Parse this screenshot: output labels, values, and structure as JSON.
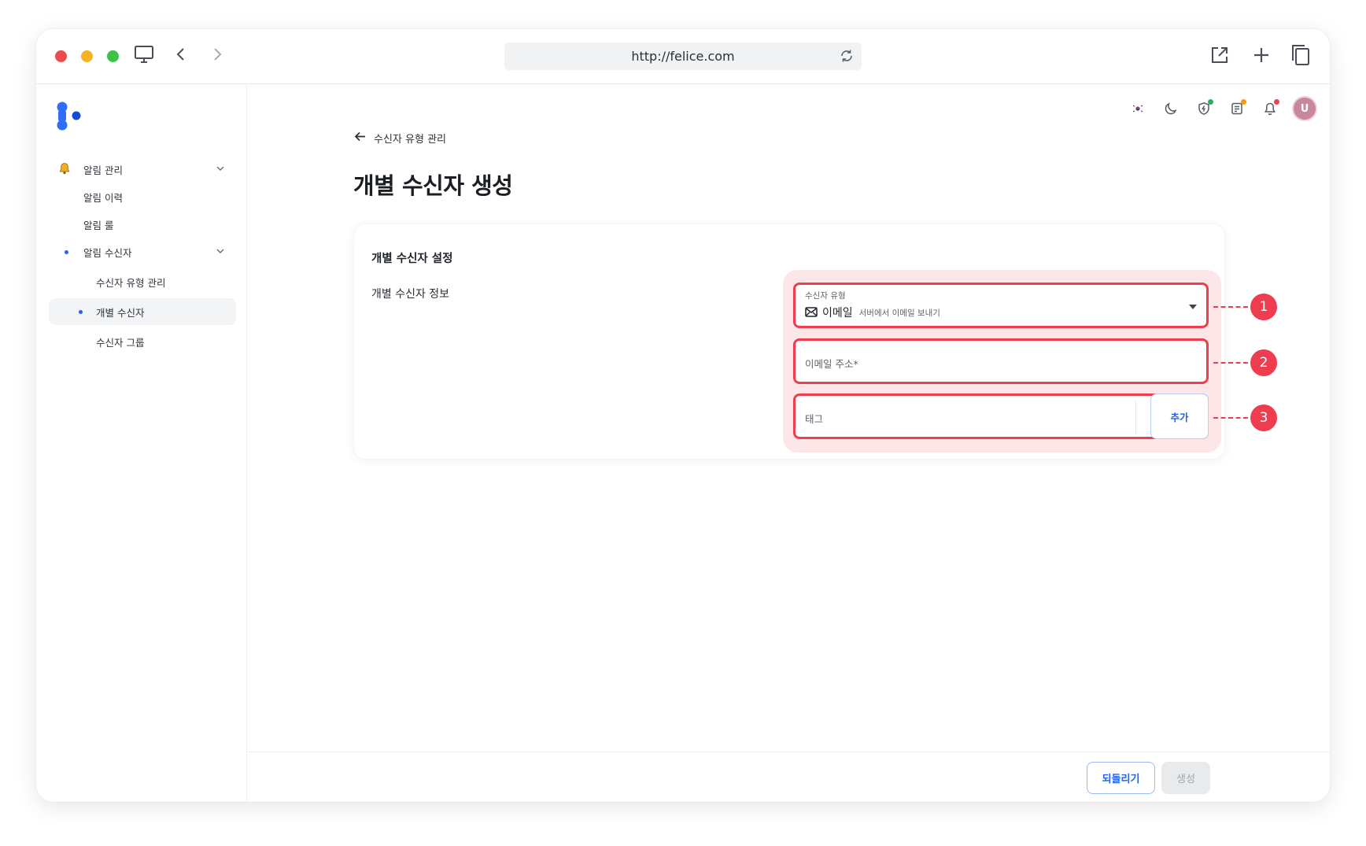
{
  "browser": {
    "url": "http://felice.com"
  },
  "sidebar": {
    "items": [
      {
        "label": "알림 관리"
      },
      {
        "label": "알림 이력"
      },
      {
        "label": "알림 룰"
      },
      {
        "label": "알림 수신자"
      },
      {
        "label": "수신자 유형 관리"
      },
      {
        "label": "개별 수신자"
      },
      {
        "label": "수신자 그룹"
      }
    ]
  },
  "header": {
    "avatar_initial": "U"
  },
  "page": {
    "back_label": "수신자 유형 관리",
    "title": "개별 수신자 생성"
  },
  "card": {
    "title": "개별 수신자 설정",
    "section_label": "개별 수신자 정보",
    "recipient_type": {
      "label": "수신자 유형",
      "value": "이메일",
      "description": "서버에서 이메일 보내기"
    },
    "email": {
      "placeholder": "이메일 주소*"
    },
    "tag": {
      "placeholder": "태그",
      "add_label": "추가"
    }
  },
  "callouts": [
    "1",
    "2",
    "3"
  ],
  "footer": {
    "reset_label": "되돌리기",
    "create_label": "생성"
  },
  "colors": {
    "accent": "#2563eb",
    "highlight": "#ee3d4f",
    "highlight_bg": "#fde6e8"
  }
}
